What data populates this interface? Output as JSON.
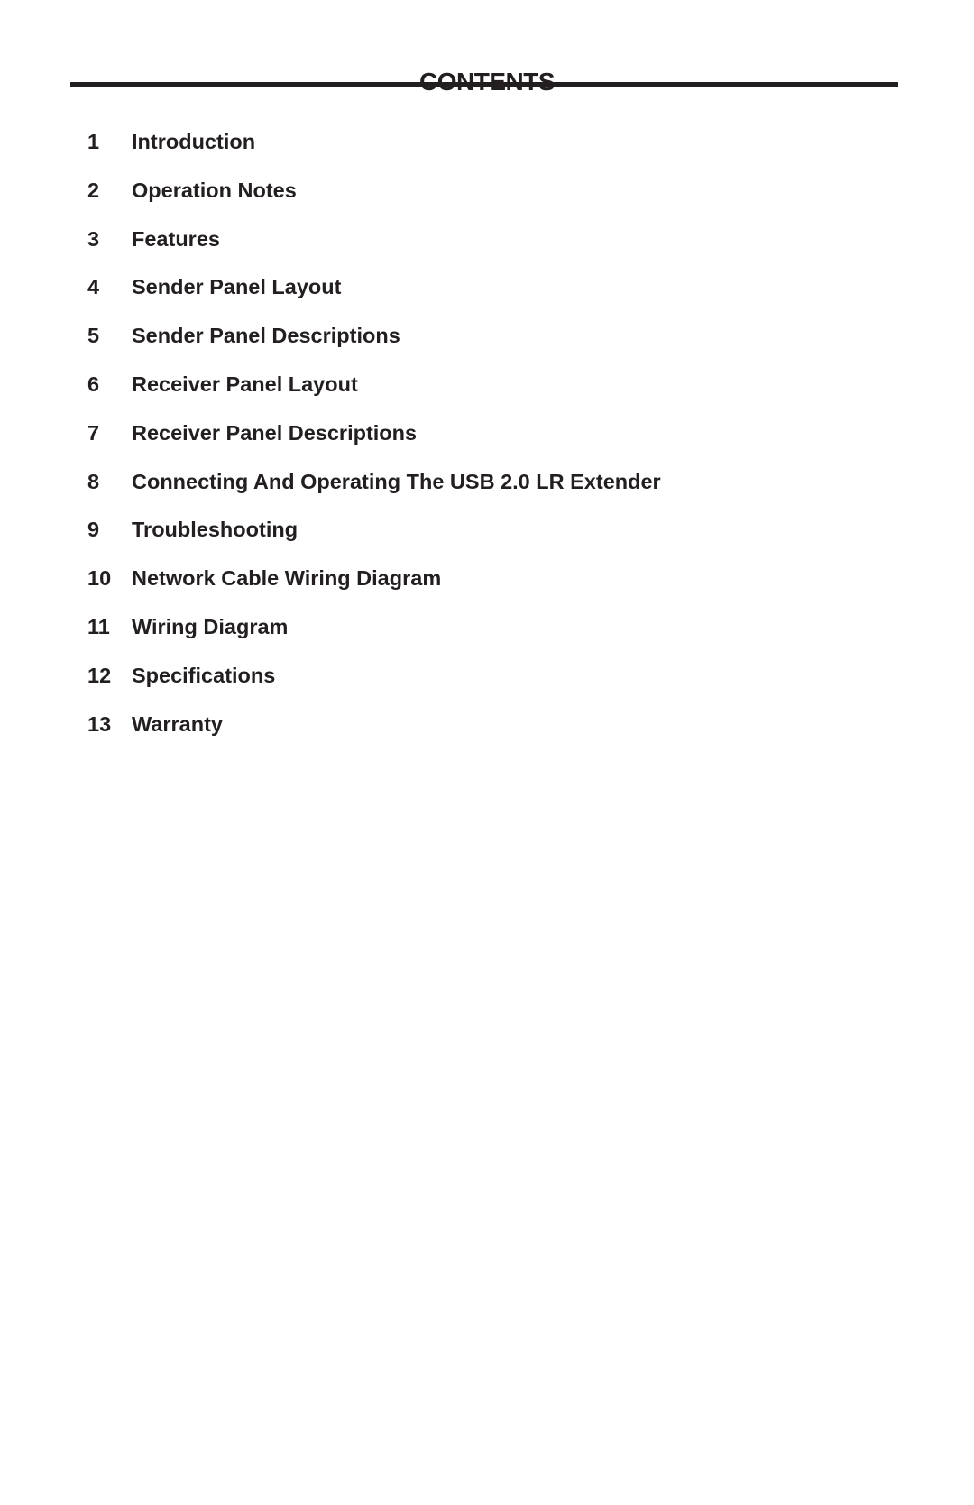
{
  "document": {
    "title": "CONTENTS",
    "toc": [
      {
        "number": "1",
        "label": "Introduction"
      },
      {
        "number": "2",
        "label": "Operation Notes"
      },
      {
        "number": "3",
        "label": "Features"
      },
      {
        "number": "4",
        "label": "Sender Panel Layout"
      },
      {
        "number": "5",
        "label": "Sender Panel Descriptions"
      },
      {
        "number": "6",
        "label": "Receiver Panel Layout"
      },
      {
        "number": "7",
        "label": "Receiver Panel Descriptions"
      },
      {
        "number": "8",
        "label": "Connecting And Operating The USB 2.0 LR Extender"
      },
      {
        "number": "9",
        "label": "Troubleshooting"
      },
      {
        "number": "10",
        "label": "Network Cable Wiring Diagram"
      },
      {
        "number": "11",
        "label": "Wiring Diagram"
      },
      {
        "number": "12",
        "label": "Specifications"
      },
      {
        "number": "13",
        "label": "Warranty"
      }
    ]
  }
}
